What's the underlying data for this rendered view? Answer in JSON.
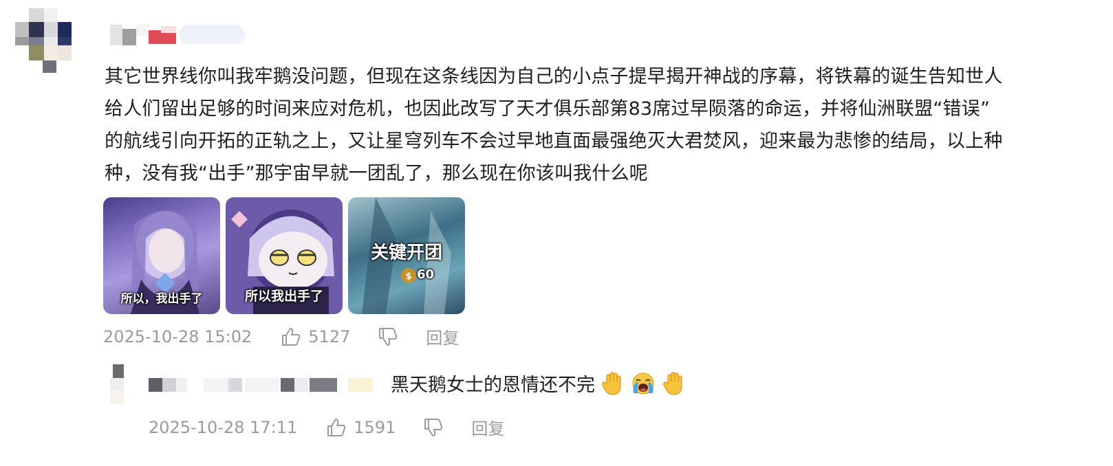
{
  "comment": {
    "lines": [
      "其它世界线你叫我牢鹅没问题，但现在这条线因为自己的小点子提早揭开神战的序幕，将铁幕的诞生告知世人",
      "给人们留出足够的时间来应对危机，也因此改写了天才俱乐部第83席过早陨落的命运，并将仙洲联盟“错误”",
      "的航线引向开拓的正轨之上，又让星穹列车不会过早地直面最强绝灭大君焚风，迎来最为悲惨的结局，以上种",
      "种，没有我“出手”那宇宙早就一团乱了，那么现在你该叫我什么呢"
    ],
    "images": [
      {
        "caption": "所以，我出手了",
        "icon": "anime-character-image"
      },
      {
        "caption": "所以我出手了",
        "icon": "chibi-character-sticker"
      },
      {
        "caption": "关键开团",
        "sub": "60",
        "icon": "game-skill-card"
      }
    ],
    "timestamp": "2025-10-28 15:02",
    "likes": "5127",
    "reply_label": "回复"
  },
  "reply": {
    "text": "黑天鹅女士的恩情还不完",
    "emojis": [
      "raised-hand-icon",
      "crying-face-icon",
      "raised-hand-icon"
    ],
    "timestamp": "2025-10-28 17:11",
    "likes": "1591",
    "reply_label": "回复"
  },
  "colors": {
    "text": "#1f1f1f",
    "meta": "#9a9a9a"
  }
}
